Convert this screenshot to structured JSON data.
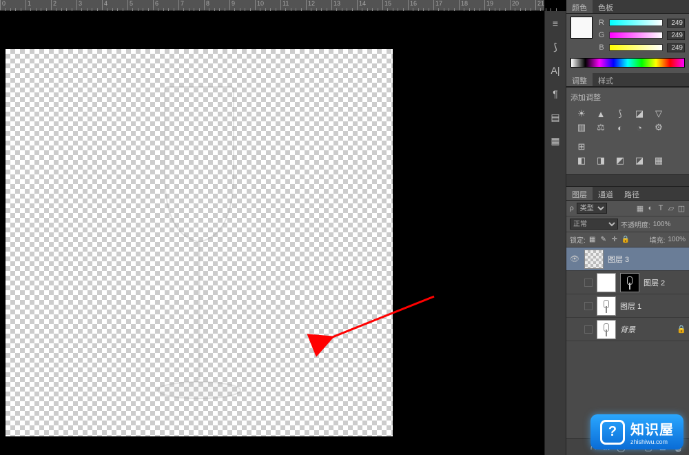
{
  "ruler": {
    "marks": [
      0,
      1,
      2,
      3,
      4,
      5,
      6,
      7,
      8,
      9,
      10,
      11,
      12,
      13,
      14,
      15,
      16,
      17,
      18,
      19,
      20,
      21
    ]
  },
  "color_panel": {
    "tabs": [
      "颜色",
      "色板"
    ],
    "active_tab": 0,
    "channels": [
      {
        "label": "R",
        "value": 249,
        "gradient": "linear-gradient(90deg,#00ffff,#ffffff)"
      },
      {
        "label": "G",
        "value": 249,
        "gradient": "linear-gradient(90deg,#ff00ff,#ffffff)"
      },
      {
        "label": "B",
        "value": 249,
        "gradient": "linear-gradient(90deg,#ffff00,#ffffff)"
      }
    ]
  },
  "adjustments_panel": {
    "tabs": [
      "调整",
      "样式"
    ],
    "active_tab": 0,
    "title": "添加调整"
  },
  "layers_panel": {
    "tabs": [
      "图层",
      "通道",
      "路径"
    ],
    "active_tab": 0,
    "filter_label": "类型",
    "blend_mode": "正常",
    "opacity_label": "不透明度:",
    "opacity_value": "100%",
    "lock_label": "锁定:",
    "fill_label": "填充:",
    "fill_value": "100%",
    "layers": [
      {
        "name": "图层 3",
        "visible": true,
        "selected": true,
        "thumb": "checker"
      },
      {
        "name": "图层 2",
        "visible": false,
        "selected": false,
        "thumb": "white",
        "mask": true
      },
      {
        "name": "图层 1",
        "visible": false,
        "selected": false,
        "thumb": "wine"
      },
      {
        "name": "背景",
        "visible": false,
        "selected": false,
        "thumb": "wine",
        "locked": true,
        "italic": true
      }
    ]
  },
  "watermark": {
    "title": "知识屋",
    "url": "zhishiwu.com",
    "icon": "?"
  }
}
